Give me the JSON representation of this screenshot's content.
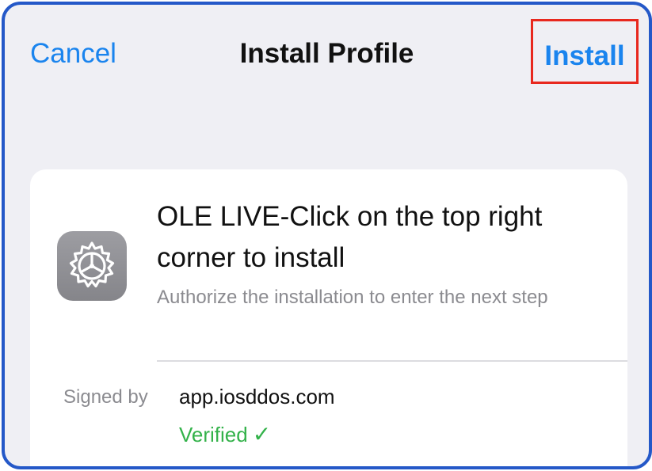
{
  "nav": {
    "cancel_label": "Cancel",
    "title": "Install Profile",
    "install_label": "Install"
  },
  "profile": {
    "icon": "settings-gear-icon",
    "name": "OLE LIVE-Click on the top right corner to install",
    "description": "Authorize the installation to enter the next step",
    "signed_by_label": "Signed by",
    "signed_by_value": "app.iosddos.com",
    "verified_label": "Verified",
    "verified_icon": "✓"
  },
  "colors": {
    "accent": "#1a84ee",
    "highlight_box": "#e8281e",
    "frame_border": "#2458c8",
    "verified": "#33b24a",
    "background": "#efeff4"
  }
}
